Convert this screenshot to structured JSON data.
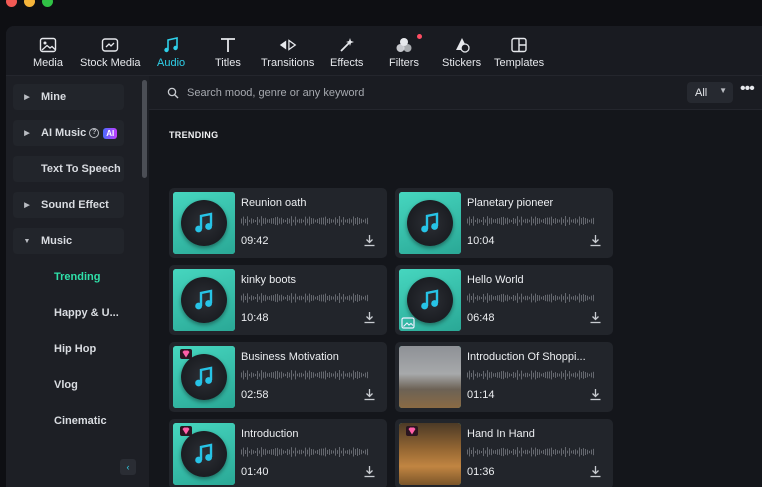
{
  "toolbar": {
    "items": [
      {
        "label": "Media",
        "icon": "media-icon"
      },
      {
        "label": "Stock Media",
        "icon": "stock-media-icon"
      },
      {
        "label": "Audio",
        "icon": "music-note-icon",
        "active": true
      },
      {
        "label": "Titles",
        "icon": "titles-icon"
      },
      {
        "label": "Transitions",
        "icon": "transitions-icon"
      },
      {
        "label": "Effects",
        "icon": "effects-icon"
      },
      {
        "label": "Filters",
        "icon": "filters-icon"
      },
      {
        "label": "Stickers",
        "icon": "stickers-icon"
      },
      {
        "label": "Templates",
        "icon": "templates-icon"
      }
    ]
  },
  "sidebar": {
    "items": [
      {
        "label": "Mine"
      },
      {
        "label": "AI Music",
        "badge": "AI"
      },
      {
        "label": "Text To Speech"
      },
      {
        "label": "Sound Effect"
      },
      {
        "label": "Music"
      }
    ],
    "music_subitems": [
      {
        "label": "Trending",
        "active": true
      },
      {
        "label": "Happy & U..."
      },
      {
        "label": "Hip Hop"
      },
      {
        "label": "Vlog"
      },
      {
        "label": "Cinematic"
      }
    ],
    "collapse_glyph": "‹"
  },
  "search": {
    "placeholder": "Search mood, genre or any keyword",
    "filter_value": "All",
    "more_glyph": "•••"
  },
  "section": {
    "title": "TRENDING"
  },
  "tracks": [
    {
      "title": "Reunion oath",
      "duration": "09:42"
    },
    {
      "title": "Planetary pioneer",
      "duration": "10:04"
    },
    {
      "title": "kinky boots",
      "duration": "10:48"
    },
    {
      "title": "Hello World",
      "duration": "06:48"
    },
    {
      "title": "Business Motivation",
      "duration": "02:58"
    },
    {
      "title": "Introduction Of Shoppi...",
      "duration": "01:14"
    },
    {
      "title": "Introduction",
      "duration": "01:40"
    },
    {
      "title": "Hand In Hand",
      "duration": "01:36"
    }
  ],
  "colors": {
    "accent": "#2fd0e9",
    "active_category": "#2fe0a9",
    "notification": "#ff4d63"
  }
}
